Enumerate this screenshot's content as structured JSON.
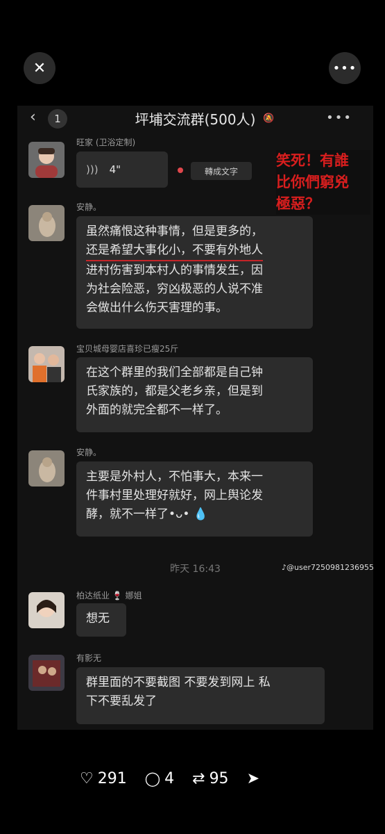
{
  "viewer": {
    "close_icon": "close-icon",
    "more_icon": "more-icon"
  },
  "chat": {
    "back_badge": "1",
    "title": "坪埔交流群(500人)",
    "messages": [
      {
        "sender": "旺家 (卫浴定制)",
        "type": "voice",
        "duration": "4\"",
        "convert_label": "轉成文字"
      },
      {
        "sender": "安静。",
        "type": "text",
        "lines": [
          "虽然痛恨这种事情，但是更多的，",
          "还是希望大事化小，不要有外地人",
          "进村伤害到本村人的事情发生，因",
          "为社会险恶，穷凶极恶的人说不准",
          "会做出什么伤天害理的事。"
        ]
      },
      {
        "sender": "宝贝城母婴店喜珍已瘦25斤",
        "type": "text",
        "lines": [
          "在这个群里的我们全部都是自己钟",
          "氏家族的，都是父老乡亲，但是到",
          "外面的就完全都不一样了。"
        ]
      },
      {
        "sender": "安静。",
        "type": "text",
        "lines": [
          "主要是外村人，不怕事大，本来一",
          "件事村里处理好就好，网上舆论发",
          "酵，就不一样了•ᴗ• 💧"
        ]
      },
      {
        "sender": "柏达纸业 🍷 娜姐",
        "type": "text",
        "lines": [
          "想无"
        ]
      },
      {
        "sender": "有影无",
        "type": "text",
        "lines": [
          "群里面的不要截图 不要发到网上  私",
          "下不要乱发了"
        ]
      }
    ],
    "time_divider": "昨天 16:43"
  },
  "overlay": {
    "lines": [
      "笑死！有誰",
      "比你們窮兇",
      "極惡？"
    ]
  },
  "watermark": "@user7250981236955",
  "stats": {
    "likes": "291",
    "comments": "4",
    "shares": "95"
  },
  "colors": {
    "background": "#000000",
    "bubble": "#2c2c2c",
    "overlay_red": "#d81e1e"
  }
}
